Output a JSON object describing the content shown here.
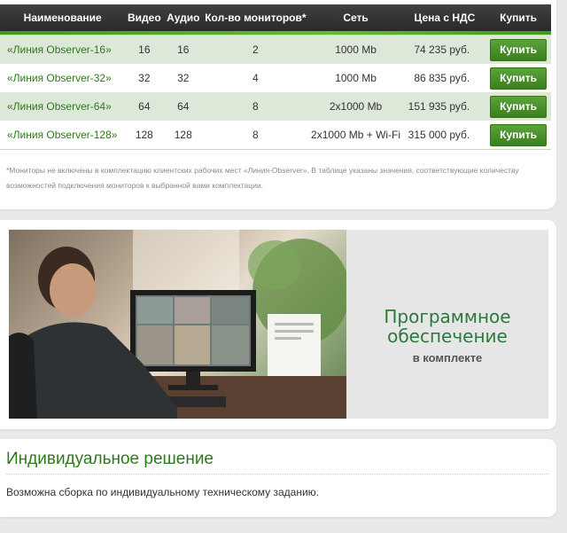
{
  "table": {
    "headers": [
      "Наименование",
      "Видео",
      "Аудио",
      "Кол-во мониторов*",
      "Сеть",
      "Цена с НДС",
      "Купить"
    ],
    "rows": [
      {
        "name": "«Линия Observer-16»",
        "video": "16",
        "audio": "16",
        "monitors": "2",
        "network": "1000 Mb",
        "price": "74 235 руб.",
        "buy": "Купить"
      },
      {
        "name": "«Линия Observer-32»",
        "video": "32",
        "audio": "32",
        "monitors": "4",
        "network": "1000 Mb",
        "price": "86 835 руб.",
        "buy": "Купить"
      },
      {
        "name": "«Линия Observer-64»",
        "video": "64",
        "audio": "64",
        "monitors": "8",
        "network": "2x1000 Mb",
        "price": "151 935 руб.",
        "buy": "Купить"
      },
      {
        "name": "«Линия Observer-128»",
        "video": "128",
        "audio": "128",
        "monitors": "8",
        "network": "2x1000 Mb + Wi-Fi",
        "price": "315 000 руб.",
        "buy": "Купить"
      }
    ],
    "footnote": "*Мониторы не включены в комплектацию клиентских рабочих мест «Линия-Observer». В таблице указаны значения, соответствующие количеству возможностей подключения мониторов к выбранной вами комплектации."
  },
  "banner": {
    "title_line1": "Программное",
    "title_line2": "обеспечение",
    "subtitle": "в комплекте"
  },
  "individual": {
    "title": "Индивидуальное решение",
    "text": "Возможна сборка по индивидуальному техническому заданию."
  },
  "colors": {
    "accent": "#2d7a1c",
    "button": "#4a8f2c",
    "header": "#333333",
    "row_alt": "#dde8d9"
  }
}
